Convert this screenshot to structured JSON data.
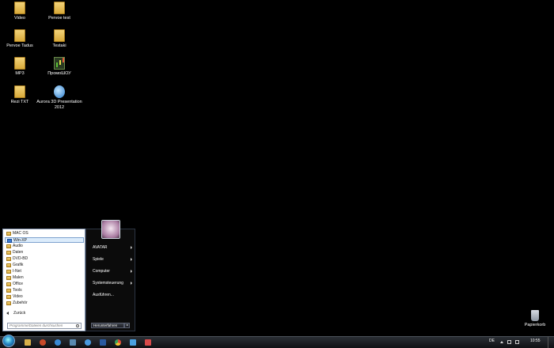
{
  "desktop": {
    "icons": [
      {
        "label": "Video",
        "type": "folder"
      },
      {
        "label": "Pervoe test",
        "type": "folder"
      },
      {
        "label": "Pervoe Tadus",
        "type": "folder"
      },
      {
        "label": "Testaki",
        "type": "folder"
      },
      {
        "label": "MP3",
        "type": "folder"
      },
      {
        "label": "ПромоШОУ",
        "type": "chart-icon"
      },
      {
        "label": "Rezi TXT",
        "type": "folder"
      },
      {
        "label": "Aurora 3D Presentation 2012",
        "type": "app-icon"
      }
    ],
    "recycle_bin": "Papierkorb"
  },
  "start_menu": {
    "left_items": [
      {
        "label": "MAC OS",
        "icon": "folder-icon"
      },
      {
        "label": "Win-XP",
        "icon": "windows-icon",
        "selected": true
      },
      {
        "label": "Audio",
        "icon": "folder-icon"
      },
      {
        "label": "Daten",
        "icon": "folder-icon"
      },
      {
        "label": "DVD-BD",
        "icon": "folder-icon"
      },
      {
        "label": "Grafik",
        "icon": "folder-icon"
      },
      {
        "label": "I-Net",
        "icon": "folder-icon"
      },
      {
        "label": "Malen",
        "icon": "folder-icon"
      },
      {
        "label": "Office",
        "icon": "folder-icon"
      },
      {
        "label": "Tools",
        "icon": "folder-icon"
      },
      {
        "label": "Video",
        "icon": "folder-icon"
      },
      {
        "label": "Zubehör",
        "icon": "folder-icon"
      }
    ],
    "back_label": "Zurück",
    "search_placeholder": "Programme/Dateien durchsuchen",
    "right_items": [
      {
        "label": "AVATAR",
        "has_submenu": true
      },
      {
        "label": "Spiele",
        "has_submenu": true
      },
      {
        "label": "Computer",
        "has_submenu": true
      },
      {
        "label": "Systemsteuerung",
        "has_submenu": true
      },
      {
        "label": "Ausführen...",
        "has_submenu": false
      }
    ],
    "shutdown_label": "Herunterfahren"
  },
  "taskbar": {
    "language": "DE",
    "clock": "10:55"
  }
}
